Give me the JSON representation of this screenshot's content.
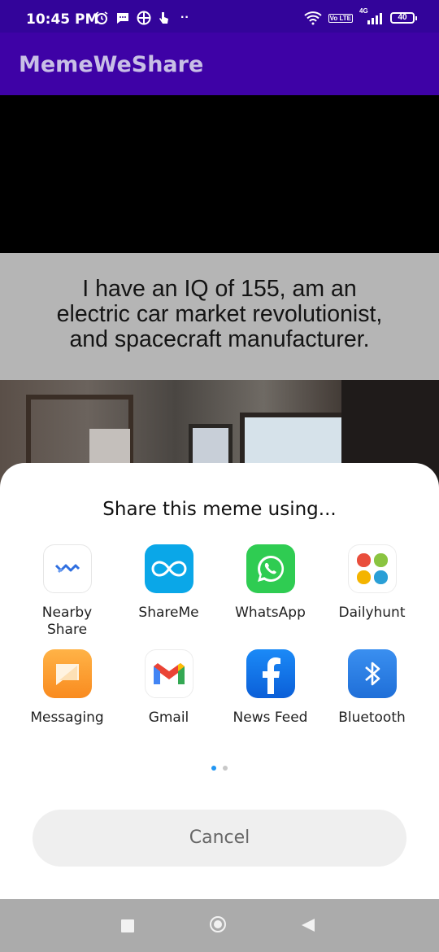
{
  "status_bar": {
    "time": "10:45 PM",
    "network": "4G",
    "vo_lte": "Vo LTE",
    "battery": "40"
  },
  "app_bar": {
    "title": "MemeWeShare"
  },
  "meme": {
    "caption": "I have an IQ of 155, am an\nelectric car market revolutionist,\n and spacecraft manufacturer."
  },
  "share_sheet": {
    "title": "Share this meme using...",
    "apps": [
      {
        "label": "Nearby\nShare",
        "icon": "nearby-share-icon"
      },
      {
        "label": "ShareMe",
        "icon": "shareme-icon"
      },
      {
        "label": "WhatsApp",
        "icon": "whatsapp-icon"
      },
      {
        "label": "Dailyhunt",
        "icon": "dailyhunt-icon"
      },
      {
        "label": "Messaging",
        "icon": "messaging-icon"
      },
      {
        "label": "Gmail",
        "icon": "gmail-icon"
      },
      {
        "label": "News Feed",
        "icon": "facebook-icon"
      },
      {
        "label": "Bluetooth",
        "icon": "bluetooth-icon"
      }
    ],
    "page_indicator": {
      "pages": 2,
      "current": 1,
      "active_color": "#2196f3",
      "inactive_color": "#c8c8c8"
    },
    "cancel_label": "Cancel"
  },
  "colors": {
    "status_bar": "#33049a",
    "app_bar": "#3e02a6",
    "caption_band": "#b5b5b5"
  }
}
